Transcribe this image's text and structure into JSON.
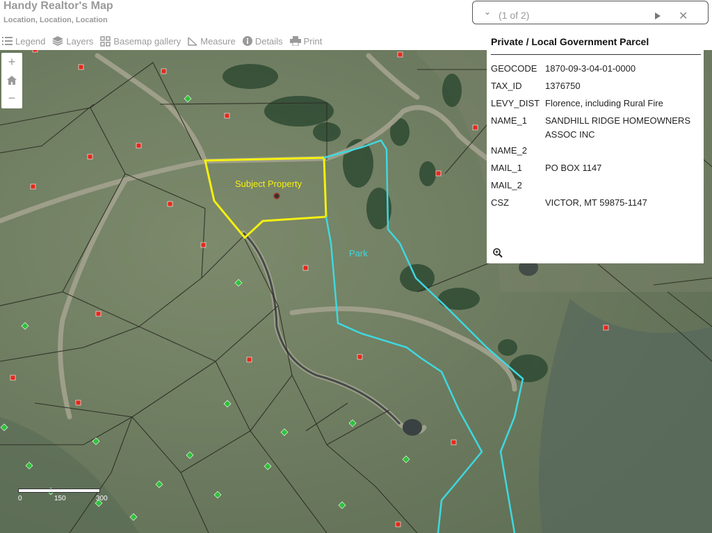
{
  "app": {
    "title": "Handy Realtor's Map",
    "subtitle": "Location, Location, Location"
  },
  "toolbar": {
    "legend": "Legend",
    "layers": "Layers",
    "basemap": "Basemap gallery",
    "measure": "Measure",
    "details": "Details",
    "print": "Print"
  },
  "zoom": {
    "in": "+",
    "home": "⌂",
    "out": "−"
  },
  "map_labels": {
    "subject": "Subject Property",
    "park": "Park"
  },
  "scalebar": {
    "labels": [
      "0",
      "150",
      "300"
    ]
  },
  "colors": {
    "subject_outline": "#f5f010",
    "park_outline": "#3fd8e0",
    "parcel_lines": "#2b2b22",
    "point_red": "#e02a1c",
    "point_green": "#2fc23a"
  },
  "popup": {
    "count": "(1 of 2)",
    "title": "Private / Local Government Parcel",
    "fields": [
      {
        "key": "GEOCODE",
        "value": "1870-09-3-04-01-0000"
      },
      {
        "key": "TAX_ID",
        "value": "1376750"
      },
      {
        "key": "LEVY_DIST",
        "value": "Florence, including Rural Fire"
      },
      {
        "key": "NAME_1",
        "value": "SANDHILL RIDGE HOMEOWNERS ASSOC INC"
      },
      {
        "key": "NAME_2",
        "value": ""
      },
      {
        "key": "MAIL_1",
        "value": "PO BOX 1147"
      },
      {
        "key": "MAIL_2",
        "value": ""
      },
      {
        "key": "CSZ",
        "value": "VICTOR, MT 59875-1147"
      }
    ]
  }
}
